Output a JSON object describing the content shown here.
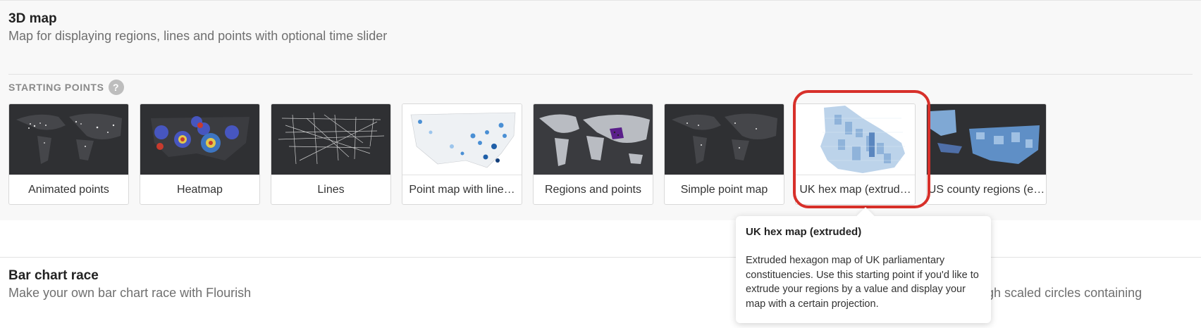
{
  "section_map": {
    "title": "3D map",
    "description": "Map for displaying regions, lines and points with optional time slider",
    "starting_points_label": "STARTING POINTS",
    "help_icon_text": "?",
    "cards": [
      {
        "label": "Animated points",
        "thumb": "dark-world-dots"
      },
      {
        "label": "Heatmap",
        "thumb": "us-heatmap"
      },
      {
        "label": "Lines",
        "thumb": "us-lines"
      },
      {
        "label": "Point map with line…",
        "thumb": "light-us-points"
      },
      {
        "label": "Regions and points",
        "thumb": "dark-world-regions"
      },
      {
        "label": "Simple point map",
        "thumb": "dark-world-dots"
      },
      {
        "label": "UK hex map (extrud…",
        "thumb": "uk-hex"
      },
      {
        "label": "US county regions (e…",
        "thumb": "us-county"
      }
    ]
  },
  "section_bar": {
    "title": "Bar chart race",
    "description": "Make your own bar chart race with Flourish"
  },
  "background_partial_text": "ugh scaled circles containing",
  "tooltip": {
    "title": "UK hex map (extruded)",
    "body": "Extruded hexagon map of UK parliamentary constituencies. Use this starting point if you'd like to extrude your regions by a value and display your map with a certain projection."
  },
  "colors": {
    "highlight": "#d7302a",
    "dark_map_bg": "#2f3033",
    "land_gray": "#4a4b4f"
  }
}
